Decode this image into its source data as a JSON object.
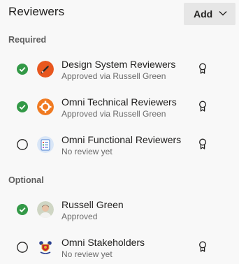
{
  "header": {
    "title": "Reviewers",
    "add_label": "Add"
  },
  "sections": {
    "required_label": "Required",
    "optional_label": "Optional"
  },
  "reviewers": [
    {
      "name": "Design System Reviewers",
      "status": "Approved via Russell Green",
      "vote": "approved",
      "avatar": "design-system-group-avatar",
      "required": true
    },
    {
      "name": "Omni Technical Reviewers",
      "status": "Approved via Russell Green",
      "vote": "approved",
      "avatar": "omni-technical-group-avatar",
      "required": true
    },
    {
      "name": "Omni Functional Reviewers",
      "status": "No review yet",
      "vote": "none",
      "avatar": "omni-functional-group-avatar",
      "required": true
    },
    {
      "name": "Russell Green",
      "status": "Approved",
      "vote": "approved",
      "avatar": "user-photo-avatar",
      "required": false
    },
    {
      "name": "Omni Stakeholders",
      "status": "No review yet",
      "vote": "none",
      "avatar": "omni-stakeholders-crest-avatar",
      "required": false
    }
  ],
  "colors": {
    "approved": "#339947",
    "accent_orange": "#e8571f",
    "button_bg": "#e6e6e6",
    "background": "#f8f8f8"
  }
}
